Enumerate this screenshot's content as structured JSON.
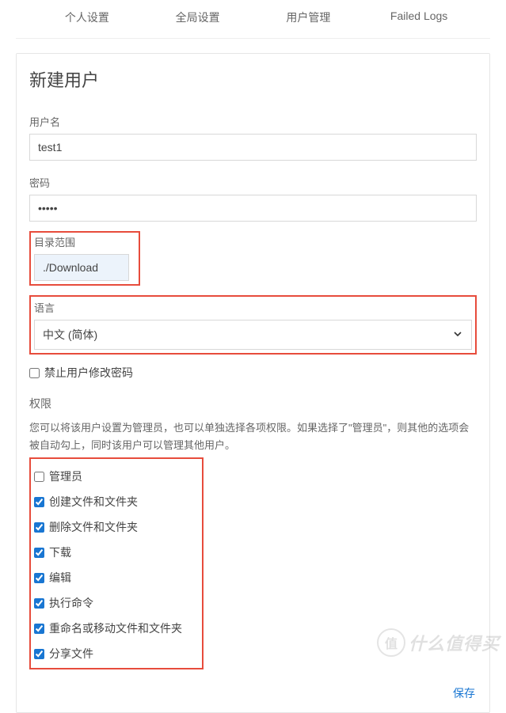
{
  "tabs": {
    "personal": "个人设置",
    "global": "全局设置",
    "users": "用户管理",
    "failed": "Failed Logs"
  },
  "card": {
    "title": "新建用户"
  },
  "fields": {
    "username_label": "用户名",
    "username_value": "test1",
    "password_label": "密码",
    "password_value": "•••••",
    "scope_label": "目录范围",
    "scope_value": "./Download",
    "language_label": "语言",
    "language_value": "中文 (简体)"
  },
  "lockpw": {
    "label": "禁止用户修改密码",
    "checked": false
  },
  "permissions": {
    "title": "权限",
    "desc": "您可以将该用户设置为管理员，也可以单独选择各项权限。如果选择了\"管理员\"，则其他的选项会被自动勾上，同时该用户可以管理其他用户。",
    "items": [
      {
        "key": "admin",
        "label": "管理员",
        "checked": false
      },
      {
        "key": "create",
        "label": "创建文件和文件夹",
        "checked": true
      },
      {
        "key": "delete",
        "label": "删除文件和文件夹",
        "checked": true
      },
      {
        "key": "download",
        "label": "下载",
        "checked": true
      },
      {
        "key": "edit",
        "label": "编辑",
        "checked": true
      },
      {
        "key": "exec",
        "label": "执行命令",
        "checked": true
      },
      {
        "key": "rename",
        "label": "重命名或移动文件和文件夹",
        "checked": true
      },
      {
        "key": "share",
        "label": "分享文件",
        "checked": true
      }
    ]
  },
  "actions": {
    "save": "保存"
  },
  "watermark": {
    "badge": "值",
    "text": "什么值得买"
  }
}
